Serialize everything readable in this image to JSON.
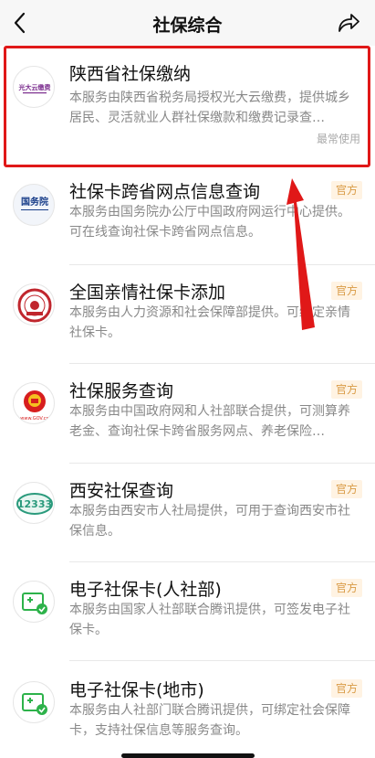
{
  "navbar": {
    "title": "社保综合"
  },
  "items": [
    {
      "title": "陕西省社保缴纳",
      "desc": "本服务由陕西省税务局授权光大云缴费，提供城乡居民、灵活就业人群社保缴款和缴费记录查…",
      "tag": "最常使用",
      "logo_text": "光大云缴费"
    },
    {
      "title": "社保卡跨省网点信息查询",
      "desc": "本服务由国务院办公厅中国政府网运行中心提供。可在线查询社保卡跨省网点信息。",
      "badge": "官方",
      "logo_text": "国务院"
    },
    {
      "title": "全国亲情社保卡添加",
      "desc": "本服务由人力资源和社会保障部提供。可绑定亲情社保卡。",
      "badge": "官方"
    },
    {
      "title": "社保服务查询",
      "desc": "本服务由中国政府网和人社部联合提供，可测算养老金、查询社保卡跨省服务网点、养老保险…",
      "badge": "官方",
      "logo_text": "www.GOV.cn"
    },
    {
      "title": "西安社保查询",
      "desc": "本服务由西安市人社局提供，可用于查询西安市社保信息。",
      "badge": "官方",
      "logo_text": "12333"
    },
    {
      "title": "电子社保卡(人社部)",
      "desc": "本服务由国家人社部联合腾讯提供，可签发电子社保卡。",
      "badge": "官方"
    },
    {
      "title": "电子社保卡(地市)",
      "desc": "本服务由人社部门联合腾讯提供，可绑定社会保障卡，支持社保信息等服务查询。",
      "badge": "官方"
    }
  ],
  "colors": {
    "highlight": "#e01818",
    "badge_bg": "#fff3e3",
    "badge_text": "#d99a44",
    "green": "#2db24a"
  }
}
